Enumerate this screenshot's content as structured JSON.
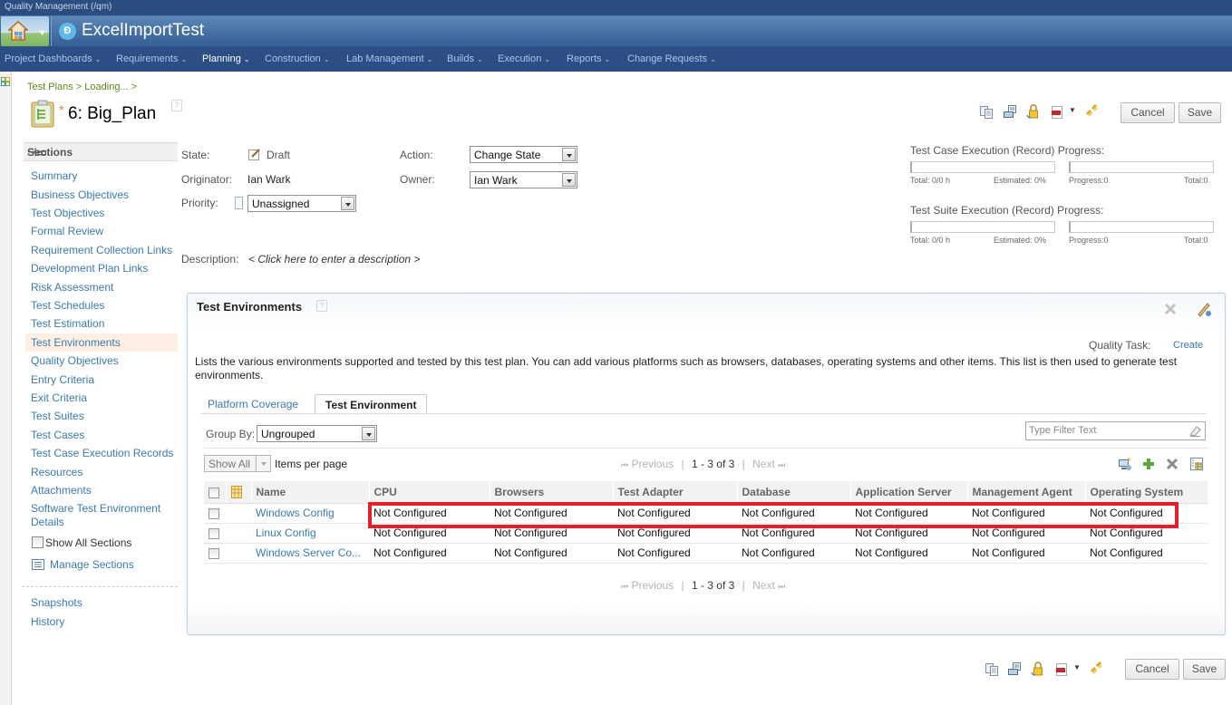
{
  "app": {
    "top_label": "Quality Management (/qm)",
    "project_title": "ExcelImportTest"
  },
  "nav": {
    "items": [
      {
        "label": "Project Dashboards"
      },
      {
        "label": "Requirements"
      },
      {
        "label": "Planning",
        "active": true
      },
      {
        "label": "Construction"
      },
      {
        "label": "Lab Management"
      },
      {
        "label": "Builds"
      },
      {
        "label": "Execution"
      },
      {
        "label": "Reports"
      },
      {
        "label": "Change Requests"
      }
    ],
    "chevron": "⌄"
  },
  "header": {
    "breadcrumb": "Test Plans > Loading... >",
    "dirty_marker": "*",
    "plan_title": "6: Big_Plan",
    "help": "?",
    "toolbar_icons": [
      "duplicate-icon",
      "print-icon",
      "lock-icon",
      "pdf-icon",
      "dropdown-icon",
      "link-icon"
    ],
    "cancel_label": "Cancel",
    "save_label": "Save"
  },
  "sidebar": {
    "header": "Sections",
    "items": [
      {
        "label": "Summary"
      },
      {
        "label": "Business Objectives"
      },
      {
        "label": "Test Objectives"
      },
      {
        "label": "Formal Review"
      },
      {
        "label": "Requirement Collection Links"
      },
      {
        "label": "Development Plan Links"
      },
      {
        "label": "Risk Assessment"
      },
      {
        "label": "Test Schedules"
      },
      {
        "label": "Test Estimation"
      },
      {
        "label": "Test Environments",
        "selected": true
      },
      {
        "label": "Quality Objectives"
      },
      {
        "label": "Entry Criteria"
      },
      {
        "label": "Exit Criteria"
      },
      {
        "label": "Test Suites"
      },
      {
        "label": "Test Cases"
      },
      {
        "label": "Test Case Execution Records"
      },
      {
        "label": "Resources"
      },
      {
        "label": "Attachments"
      },
      {
        "label": "Software Test Environment Details"
      }
    ],
    "show_all_label": "Show All Sections",
    "show_all_checked": false,
    "manage_label": "Manage Sections",
    "bottom_items": [
      {
        "label": "Snapshots"
      },
      {
        "label": "History"
      }
    ]
  },
  "form": {
    "state_label": "State:",
    "state_value": "Draft",
    "originator_label": "Originator:",
    "originator_value": "Ian Wark",
    "priority_label": "Priority:",
    "priority_value": "Unassigned",
    "action_label": "Action:",
    "action_value": "Change State",
    "owner_label": "Owner:",
    "owner_value": "Ian Wark",
    "description_label": "Description:",
    "description_placeholder": "< Click here to enter a description >"
  },
  "progress": {
    "test_case": {
      "title": "Test Case Execution (Record) Progress:",
      "total": "Total: 0/0 h",
      "estimated": "Estimated: 0%",
      "progress": "Progress:0",
      "total_count": "Total:0",
      "left_fraction": 0,
      "right_fraction": 0
    },
    "test_suite": {
      "title": "Test Suite Execution (Record) Progress:",
      "total": "Total: 0/0 h",
      "estimated": "Estimated: 0%",
      "progress": "Progress:0",
      "total_count": "Total:0",
      "left_fraction": 0,
      "right_fraction": 0
    }
  },
  "panel": {
    "title": "Test Environments",
    "help": "?",
    "quality_task_label": "Quality Task:",
    "quality_task_link": "Create",
    "description": "Lists the various environments supported and tested by this test plan. You can add various platforms such as browsers, databases, operating systems and other items. This list is then used to generate test environments.",
    "tabs": [
      {
        "label": "Platform Coverage",
        "active": false
      },
      {
        "label": "Test Environment",
        "active": true
      }
    ],
    "group_by_label": "Group By:",
    "group_by_value": "Ungrouped",
    "filter_placeholder": "Type Filter Text",
    "items_per_page_value": "Show All",
    "items_per_page_label": "Items per page",
    "pager": {
      "previous": "Previous",
      "count": "1 - 3 of 3",
      "next": "Next",
      "sep": "|",
      "first_glyph": "⏮",
      "last_glyph": "⏭"
    },
    "table": {
      "columns": [
        "Name",
        "CPU",
        "Browsers",
        "Test Adapter",
        "Database",
        "Application Server",
        "Management Agent",
        "Operating System"
      ],
      "rows": [
        {
          "name": "Windows Config",
          "cells": [
            "Not Configured",
            "Not Configured",
            "Not Configured",
            "Not Configured",
            "Not Configured",
            "Not Configured",
            "Not Configured"
          ],
          "highlighted": true
        },
        {
          "name": "Linux Config",
          "cells": [
            "Not Configured",
            "Not Configured",
            "Not Configured",
            "Not Configured",
            "Not Configured",
            "Not Configured",
            "Not Configured"
          ]
        },
        {
          "name": "Windows Server Co...",
          "cells": [
            "Not Configured",
            "Not Configured",
            "Not Configured",
            "Not Configured",
            "Not Configured",
            "Not Configured",
            "Not Configured"
          ]
        }
      ]
    }
  },
  "colors": {
    "nav_bg": "#2b4f85",
    "link": "#3a7ab0",
    "breadcrumb": "#5a8a1a",
    "highlight_box": "#e3202a",
    "selected_section_bg": "#fdf0e2"
  }
}
